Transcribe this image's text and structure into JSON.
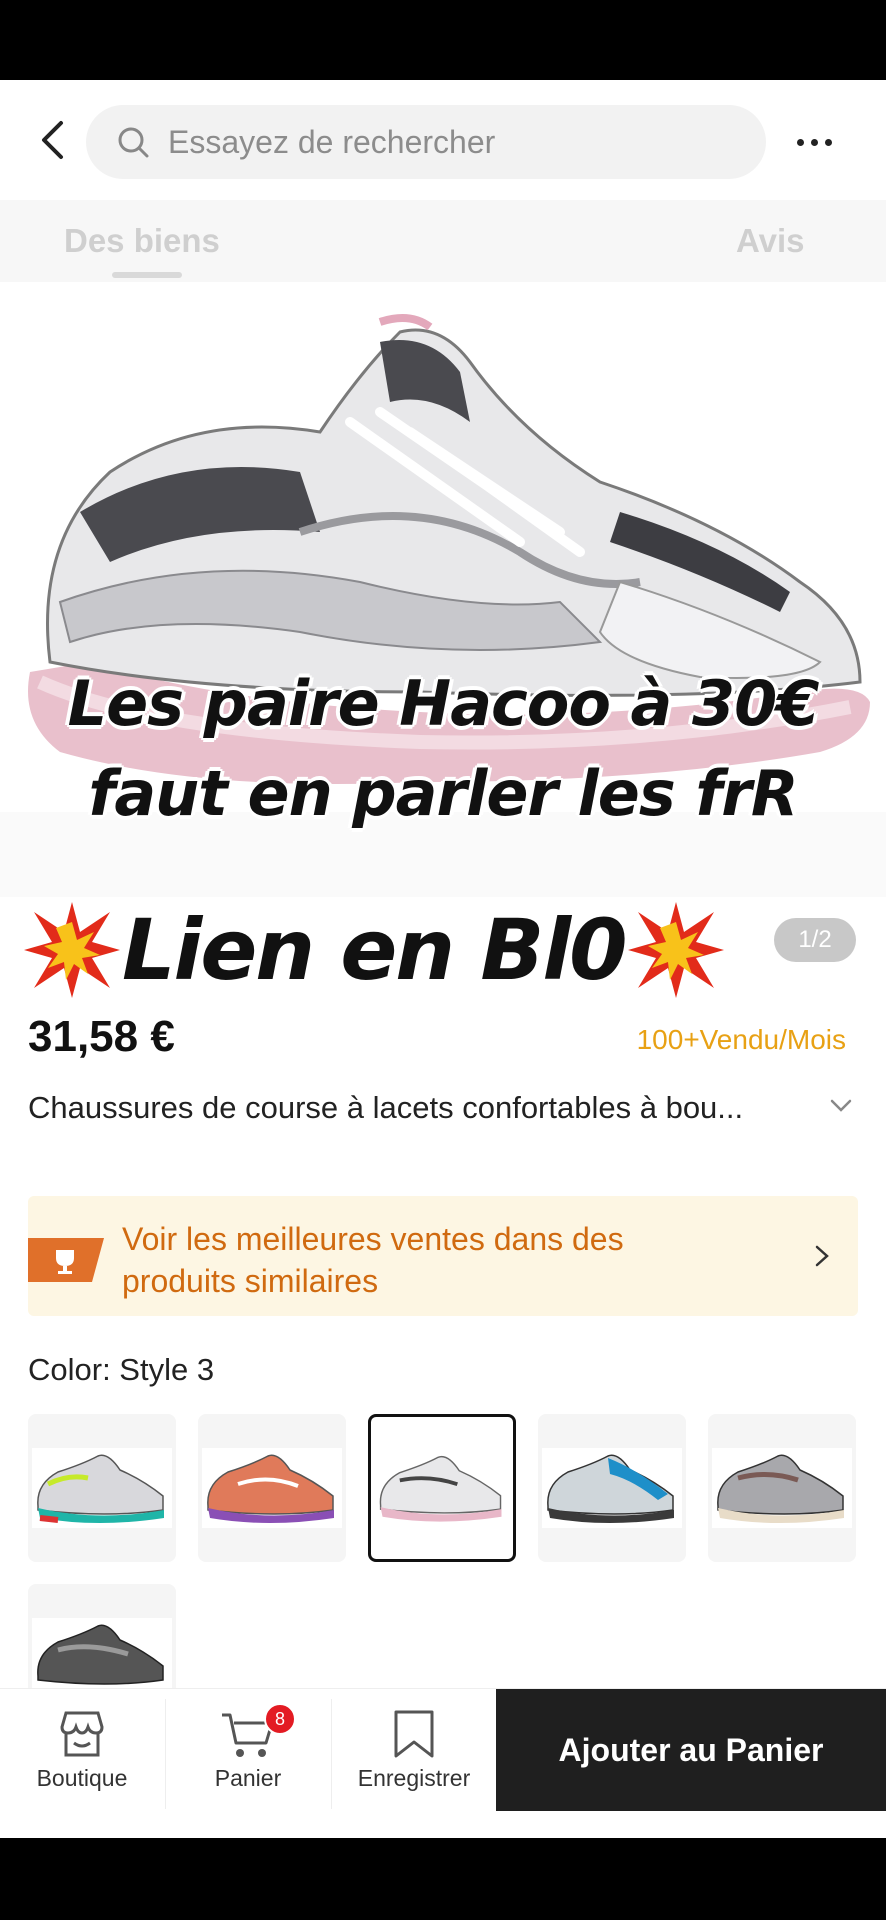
{
  "search": {
    "placeholder": "Essayez de rechercher"
  },
  "tabs": [
    {
      "label": "Des biens"
    },
    {
      "label": "Avis"
    }
  ],
  "gallery": {
    "counter": "1/2"
  },
  "overlay": {
    "line1": "Les paire Hacoo à 30€",
    "line2": "faut en parler les frR",
    "lien": "Lien en Bl0"
  },
  "product": {
    "price": "31,58 €",
    "sold": "100+Vendu/Mois",
    "title": "Chaussures de course à lacets confortables à bou..."
  },
  "promo": {
    "text": "Voir les meilleures ventes dans des produits similaires"
  },
  "color": {
    "label": "Color:  Style 3"
  },
  "swatches": [
    {
      "name": "style-1",
      "accent": "#1fb5a8",
      "accent2": "#c6ea2a"
    },
    {
      "name": "style-2",
      "accent": "#e07a5a",
      "accent2": "#8a4fb5"
    },
    {
      "name": "style-3",
      "accent": "#e8b7c8",
      "accent2": "#c0c0c0"
    },
    {
      "name": "style-4",
      "accent": "#1e8fc9",
      "accent2": "#3a3a3a"
    },
    {
      "name": "style-5",
      "accent": "#7a5a55",
      "accent2": "#e8dcc8"
    },
    {
      "name": "style-6",
      "accent": "#333333",
      "accent2": "#9a9a9a"
    }
  ],
  "bottom": {
    "boutique": "Boutique",
    "panier": "Panier",
    "panier_badge": "8",
    "enregistrer": "Enregistrer",
    "add": "Ajouter au Panier"
  },
  "colors": {
    "accent_orange": "#e8a114",
    "promo_text": "#d06a10",
    "badge_red": "#e31b23"
  }
}
